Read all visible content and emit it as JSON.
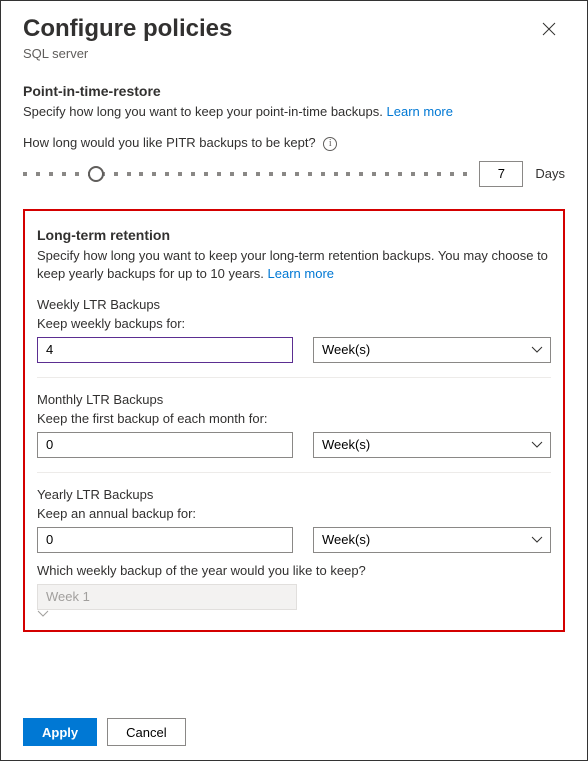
{
  "header": {
    "title": "Configure policies",
    "subtitle": "SQL server"
  },
  "pitr": {
    "heading": "Point-in-time-restore",
    "description": "Specify how long you want to keep your point-in-time backups.",
    "learn_more": "Learn more",
    "slider_label": "How long would you like PITR backups to be kept?",
    "value": "7",
    "unit": "Days"
  },
  "ltr": {
    "heading": "Long-term retention",
    "description": "Specify how long you want to keep your long-term retention backups. You may choose to keep yearly backups for up to 10 years.",
    "learn_more": "Learn more",
    "weekly": {
      "title": "Weekly LTR Backups",
      "label": "Keep weekly backups for:",
      "value": "4",
      "unit": "Week(s)"
    },
    "monthly": {
      "title": "Monthly LTR Backups",
      "label": "Keep the first backup of each month for:",
      "value": "0",
      "unit": "Week(s)"
    },
    "yearly": {
      "title": "Yearly LTR Backups",
      "label": "Keep an annual backup for:",
      "value": "0",
      "unit": "Week(s)",
      "which_week_question": "Which weekly backup of the year would you like to keep?",
      "which_week_value": "Week 1"
    }
  },
  "footer": {
    "apply": "Apply",
    "cancel": "Cancel"
  }
}
